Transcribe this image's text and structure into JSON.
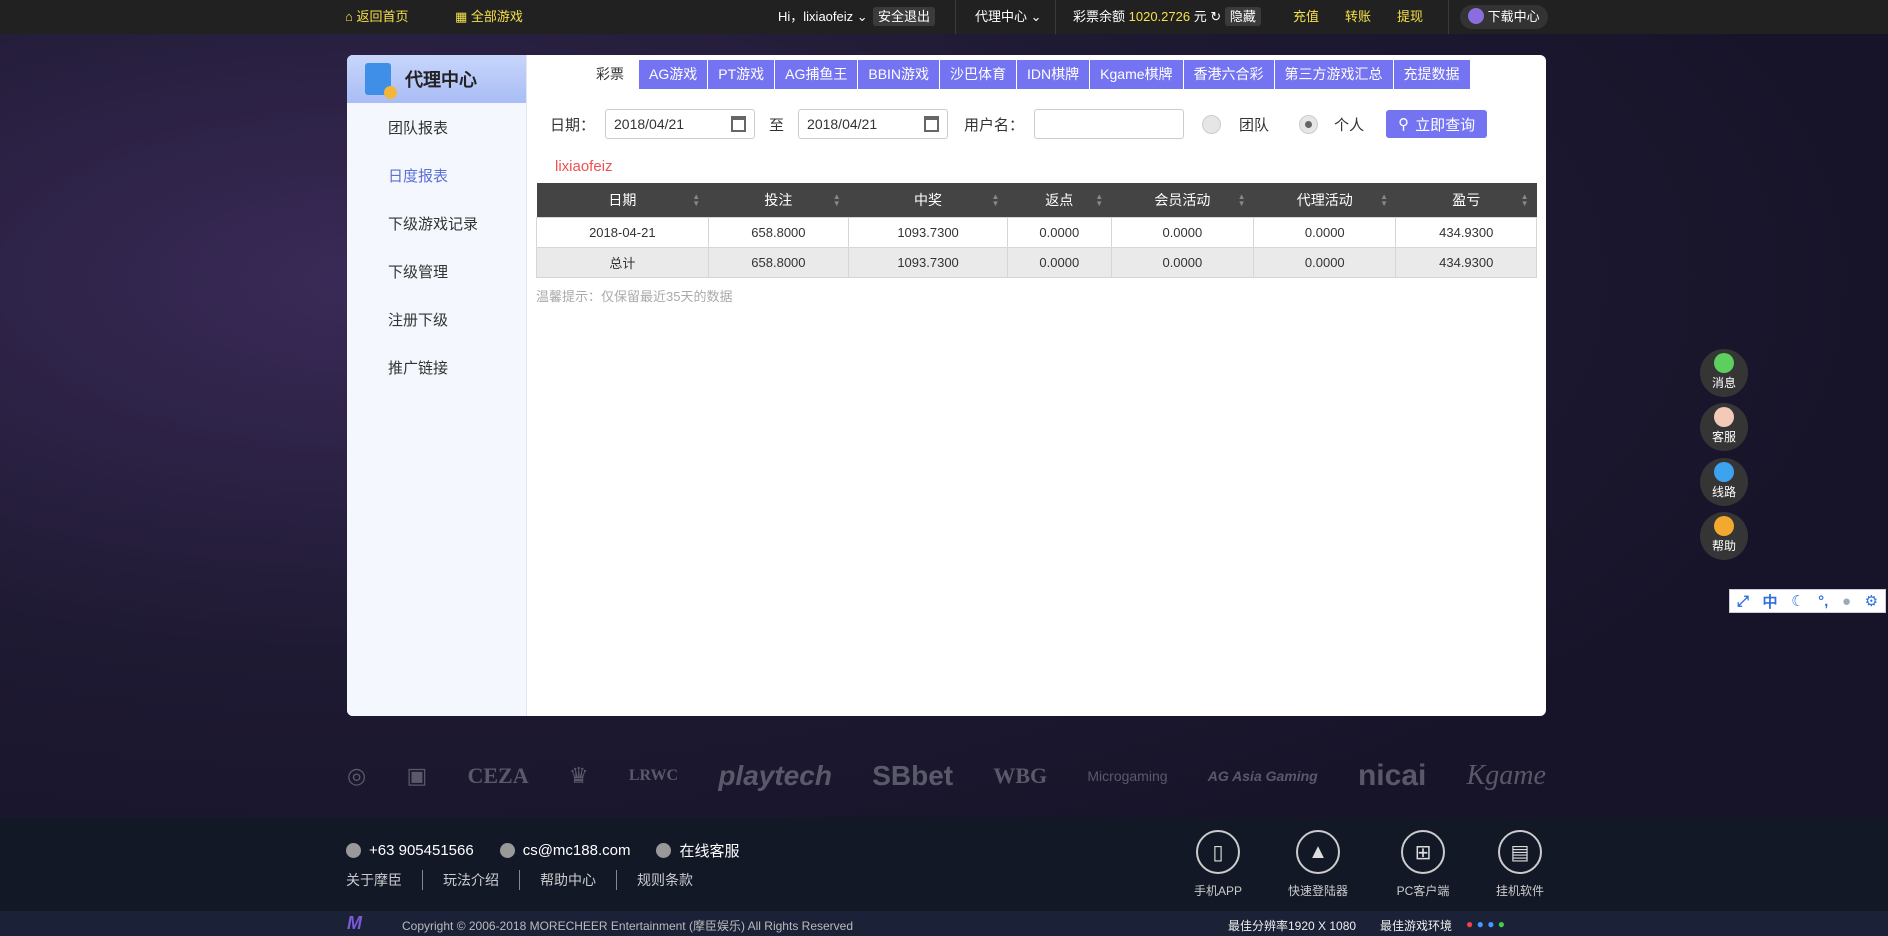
{
  "topbar": {
    "home": "返回首页",
    "all_games": "全部游戏",
    "greeting": "Hi，lixiaofeiz",
    "logout": "安全退出",
    "agent_center": "代理中心",
    "balance_label": "彩票余额",
    "balance": "1020.2726",
    "currency": "元",
    "hide": "隐藏",
    "deposit": "充值",
    "transfer": "转账",
    "withdraw": "提现",
    "download": "下载中心"
  },
  "sidebar": {
    "title": "代理中心",
    "items": [
      {
        "label": "团队报表"
      },
      {
        "label": "日度报表"
      },
      {
        "label": "下级游戏记录"
      },
      {
        "label": "下级管理"
      },
      {
        "label": "注册下级"
      },
      {
        "label": "推广链接"
      }
    ]
  },
  "tabs": [
    "彩票",
    "AG游戏",
    "PT游戏",
    "AG捕鱼王",
    "BBIN游戏",
    "沙巴体育",
    "IDN棋牌",
    "Kgame棋牌",
    "香港六合彩",
    "第三方游戏汇总",
    "充提数据"
  ],
  "form": {
    "date_label": "日期：",
    "date_from": "2018/04/21",
    "to": "至",
    "date_to": "2018/04/21",
    "username_label": "用户名：",
    "username": "",
    "team": "团队",
    "personal": "个人",
    "query": "立即查询"
  },
  "username_display": "lixiaofeiz",
  "table": {
    "headers": [
      "日期",
      "投注",
      "中奖",
      "返点",
      "会员活动",
      "代理活动",
      "盈亏"
    ],
    "rows": [
      [
        "2018-04-21",
        "658.8000",
        "1093.7300",
        "0.0000",
        "0.0000",
        "0.0000",
        "434.9300"
      ],
      [
        "总计",
        "658.8000",
        "1093.7300",
        "0.0000",
        "0.0000",
        "0.0000",
        "434.9300"
      ]
    ]
  },
  "tip": "温馨提示：仅保留最近35天的数据",
  "partners": [
    "CEZA",
    "LRWC",
    "playtech",
    "SBbet",
    "WBG",
    "Microgaming",
    "AG Asia Gaming",
    "nicai",
    "Kgame"
  ],
  "footer": {
    "phone": "+63 905451566",
    "email": "cs@mc188.com",
    "online": "在线客服",
    "links": [
      "关于摩臣",
      "玩法介绍",
      "帮助中心",
      "规则条款"
    ],
    "downloads": [
      "手机APP",
      "快速登陆器",
      "PC客户端",
      "挂机软件"
    ],
    "copyright": "Copyright © 2006-2018 MORECHEER Entertainment (摩臣娱乐) All Rights Reserved",
    "resolution": "最佳分辨率1920 X 1080",
    "env": "最佳游戏环境"
  },
  "floats": [
    "消息",
    "客服",
    "线路",
    "帮助"
  ],
  "ime": [
    "中"
  ]
}
